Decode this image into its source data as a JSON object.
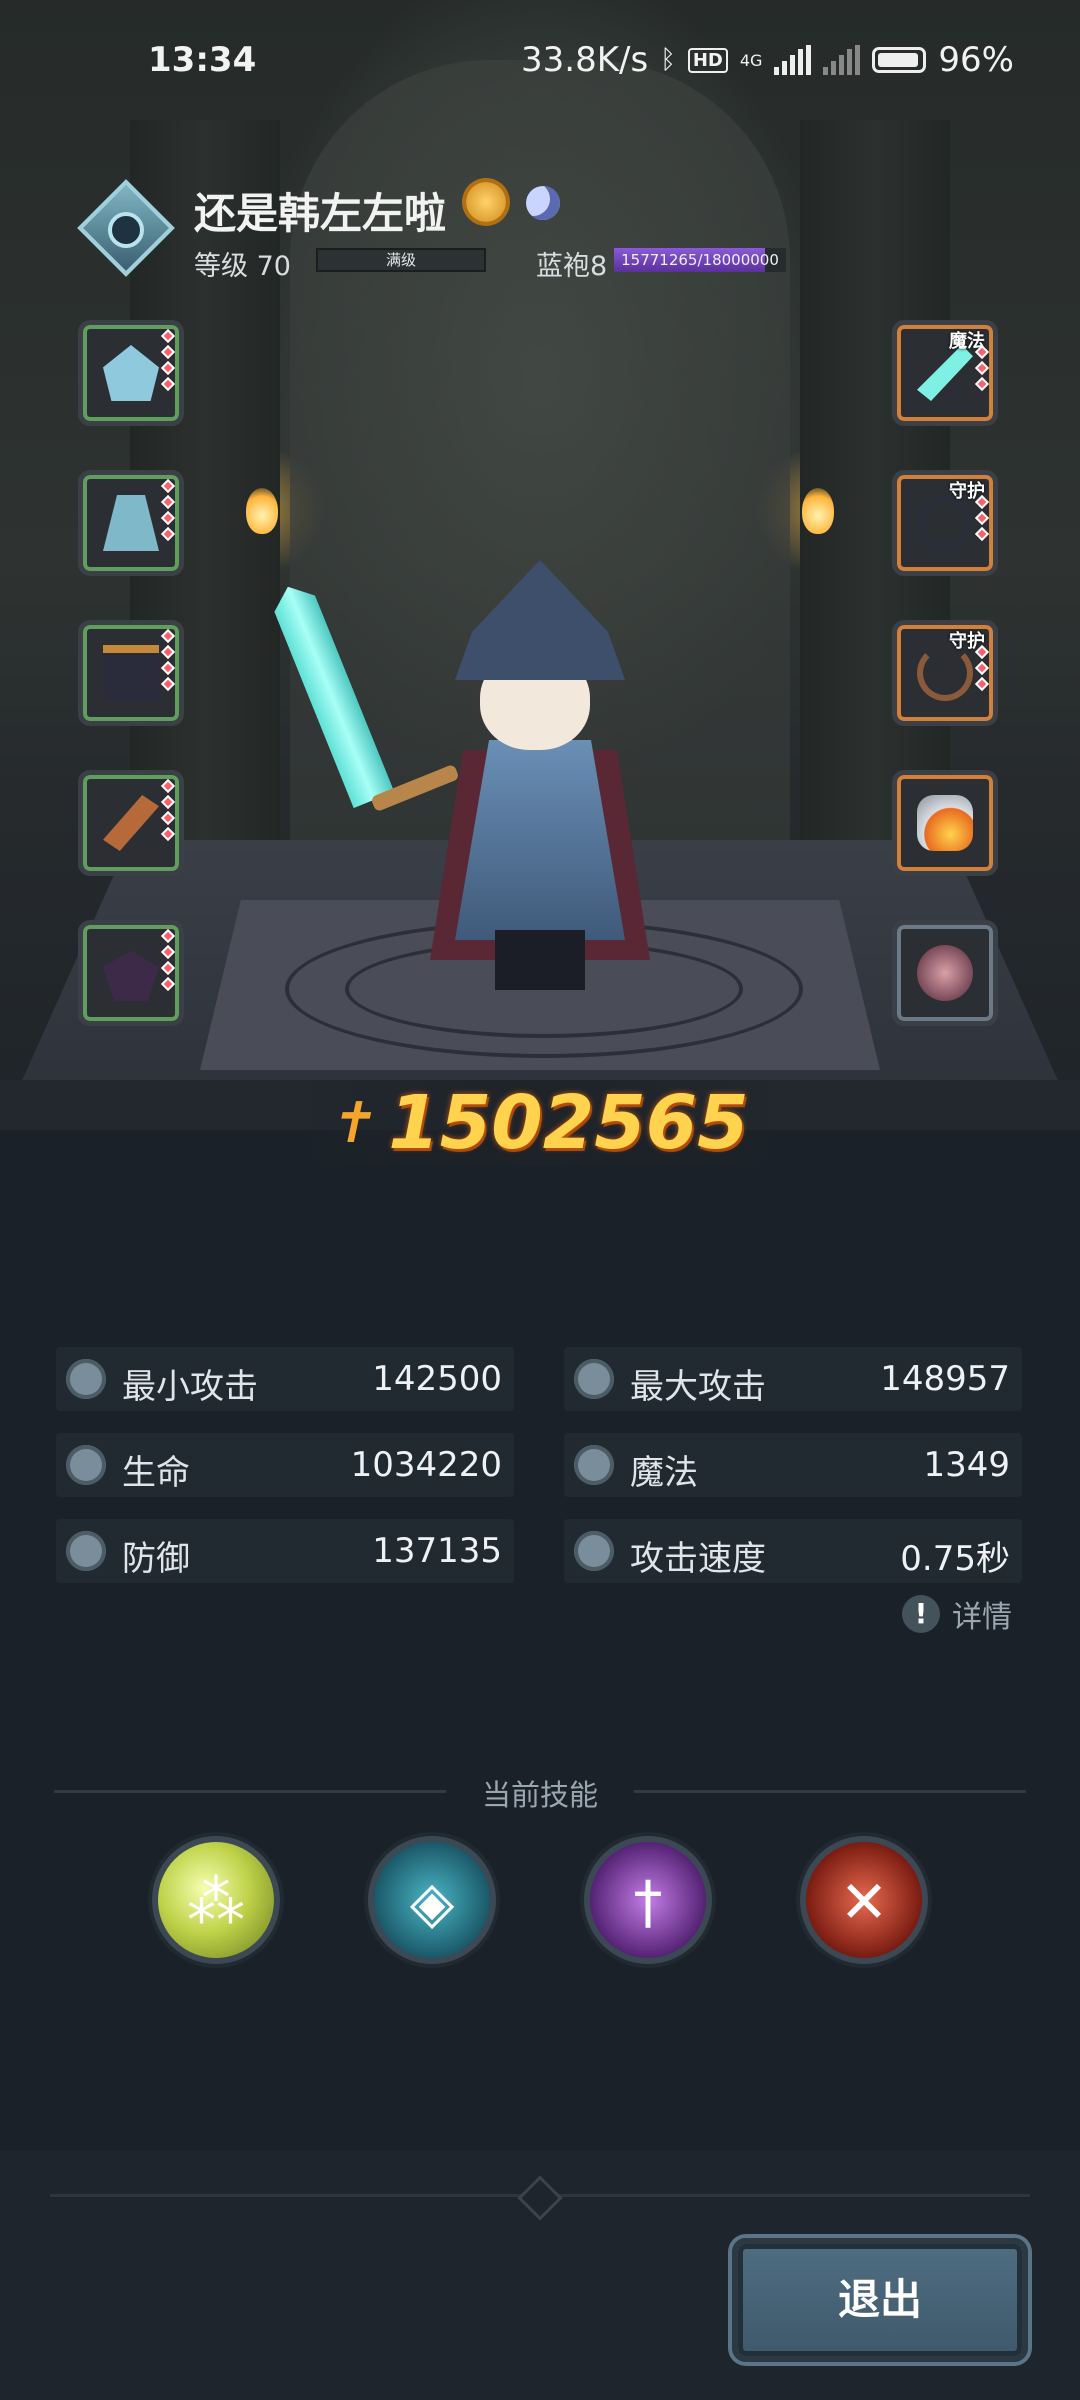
{
  "status_bar": {
    "time": "13:34",
    "network_speed": "33.8K/s",
    "bluetooth_icon": "bluetooth-icon",
    "hd_badge": "HD",
    "signal_label": "4G",
    "battery": "96%"
  },
  "player": {
    "name": "还是韩左左啦",
    "level_label": "等级 70",
    "level_status": "满级",
    "rank_label": "蓝袍8",
    "exp_text": "15771265/18000000",
    "exp_fraction": 0.876
  },
  "equipment": {
    "left": [
      {
        "name": "helmet"
      },
      {
        "name": "armor"
      },
      {
        "name": "boots"
      },
      {
        "name": "gloves"
      },
      {
        "name": "shoulder"
      }
    ],
    "right": [
      {
        "name": "weapon",
        "tag": "魔法"
      },
      {
        "name": "ring",
        "tag": "守护"
      },
      {
        "name": "necklace",
        "tag": "守护"
      },
      {
        "name": "artifact"
      },
      {
        "name": "pet"
      }
    ]
  },
  "combat_power": "1502565",
  "stats": {
    "min_attack": {
      "label": "最小攻击",
      "value": "142500"
    },
    "max_attack": {
      "label": "最大攻击",
      "value": "148957"
    },
    "hp": {
      "label": "生命",
      "value": "1034220"
    },
    "mp": {
      "label": "魔法",
      "value": "1349"
    },
    "defense": {
      "label": "防御",
      "value": "137135"
    },
    "attack_speed": {
      "label": "攻击速度",
      "value": "0.75秒"
    }
  },
  "details_label": "详情",
  "skills_title": "当前技能",
  "skills": [
    {
      "icon": "spores-icon"
    },
    {
      "icon": "water-shield-icon"
    },
    {
      "icon": "purple-dagger-icon"
    },
    {
      "icon": "crossed-axes-icon"
    }
  ],
  "exit_label": "退出",
  "colors": {
    "background": "#1a2128",
    "power": "#ffd34d",
    "exp_bar": "#8a5bd6",
    "slot_green": "#5f9e5c",
    "slot_orange": "#d2803a"
  }
}
